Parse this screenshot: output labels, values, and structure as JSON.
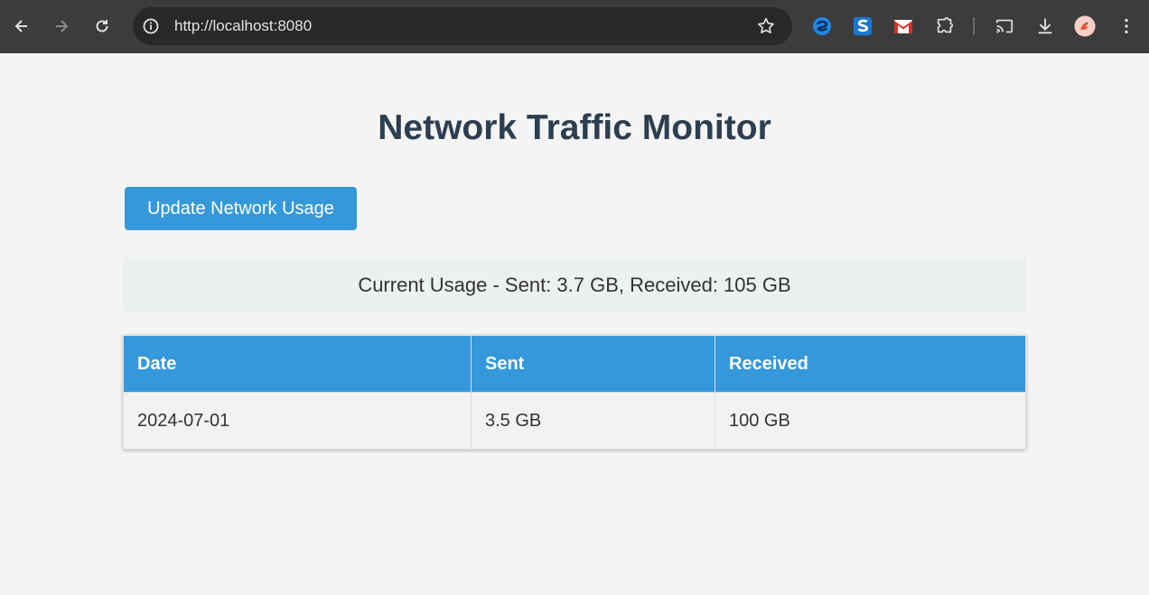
{
  "browser": {
    "url": "http://localhost:8080",
    "icons": {
      "back": "back-arrow-icon",
      "forward": "forward-arrow-icon",
      "reload": "reload-icon",
      "info": "info-icon",
      "bookmark": "star-icon",
      "extensions": [
        "blue-swirl-extension-icon",
        "s-extension-icon",
        "gmail-extension-icon",
        "puzzle-extensions-icon"
      ],
      "cast": "cast-icon",
      "download": "download-icon",
      "profile": "avatar",
      "menu": "kebab-menu-icon"
    }
  },
  "page": {
    "title": "Network Traffic Monitor",
    "update_button_label": "Update Network Usage",
    "current_usage": "Current Usage - Sent: 3.7 GB, Received: 105 GB",
    "table": {
      "headers": [
        "Date",
        "Sent",
        "Received"
      ],
      "rows": [
        [
          "2024-07-01",
          "3.5 GB",
          "100 GB"
        ]
      ]
    }
  },
  "colors": {
    "accent": "#3498db",
    "title": "#2c3e50",
    "background": "#f4f4f4",
    "usage_box": "#ecf0f1",
    "toolbar": "#3c3c3c"
  }
}
